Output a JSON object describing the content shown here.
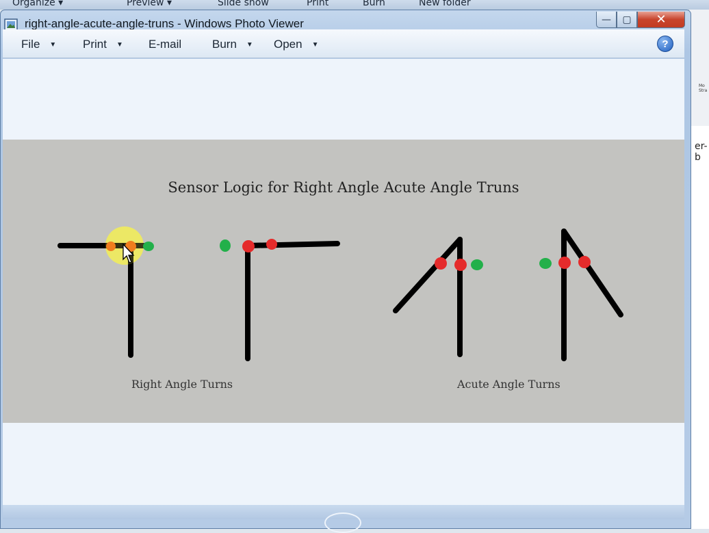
{
  "background_toolbar": {
    "items": [
      "Organize ▾",
      "Preview ▾",
      "Slide show",
      "Print",
      "Burn",
      "New folder"
    ]
  },
  "background_right": {
    "mini_text": [
      "Mo",
      "Stra"
    ],
    "partial_text": "er-b"
  },
  "window": {
    "title": "right-angle-acute-angle-truns - Windows Photo Viewer",
    "controls": {
      "minimize": "—",
      "maximize": "▢",
      "close": "✕"
    }
  },
  "menubar": {
    "items": [
      {
        "label": "File",
        "has_caret": true
      },
      {
        "label": "Print",
        "has_caret": true
      },
      {
        "label": "E-mail",
        "has_caret": false
      },
      {
        "label": "Burn",
        "has_caret": true
      },
      {
        "label": "Open",
        "has_caret": true
      }
    ],
    "help": "?"
  },
  "image": {
    "title": "Sensor Logic for Right Angle Acute Angle Truns",
    "caption_right": "Right Angle Turns",
    "caption_acute": "Acute Angle Turns",
    "colors": {
      "line": "#000000",
      "sensor_red": "#e52b2b",
      "sensor_green": "#23b04a",
      "sensor_orange": "#f07d1e",
      "highlight": "#f3ef55",
      "background": "#c3c3c0"
    }
  },
  "icons": {
    "app": "photo-viewer-icon",
    "help": "help-icon",
    "cursor": "mouse-cursor-icon",
    "caret": "chevron-down-icon"
  }
}
